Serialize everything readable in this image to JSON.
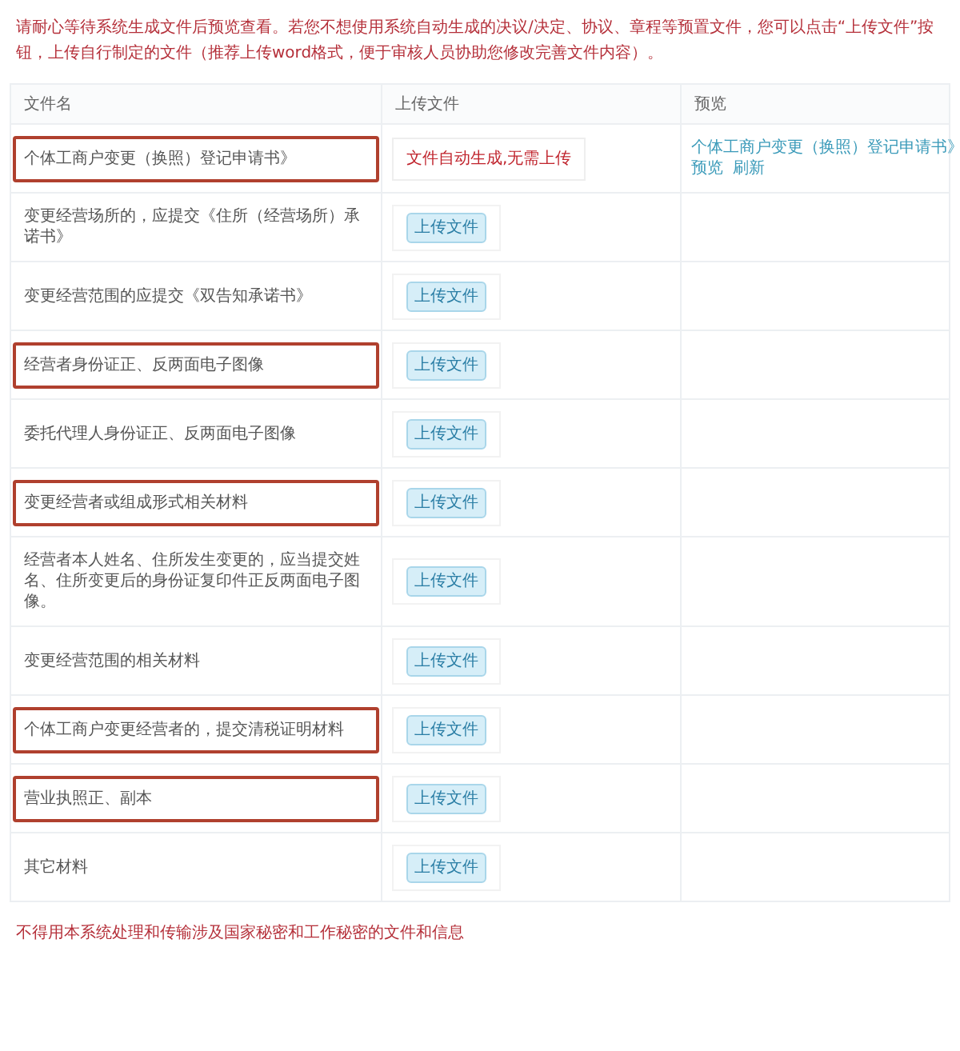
{
  "notice": "请耐心等待系统生成文件后预览查看。若您不想使用系统自动生成的决议/决定、协议、章程等预置文件，您可以点击“上传文件”按钮，上传自行制定的文件（推荐上传word格式，便于审核人员协助您修改完善文件内容）。",
  "table": {
    "columns": [
      "文件名",
      "上传文件",
      "预览"
    ],
    "rows": [
      {
        "name": "个体工商户变更（换照）登记申请书》",
        "highlighted": true,
        "upload": {
          "kind": "auto",
          "label": "文件自动生成,无需上传"
        },
        "preview": {
          "file": "个体工商户变更（换照）登记申请书》",
          "actions": [
            "预览",
            "刷新"
          ]
        }
      },
      {
        "name": "变更经营场所的，应提交《住所（经营场所）承诺书》",
        "highlighted": false,
        "upload": {
          "kind": "button",
          "label": "上传文件"
        }
      },
      {
        "name": "变更经营范围的应提交《双告知承诺书》",
        "highlighted": false,
        "upload": {
          "kind": "button",
          "label": "上传文件"
        }
      },
      {
        "name": "经营者身份证正、反两面电子图像",
        "highlighted": true,
        "upload": {
          "kind": "button",
          "label": "上传文件"
        }
      },
      {
        "name": "委托代理人身份证正、反两面电子图像",
        "highlighted": false,
        "upload": {
          "kind": "button",
          "label": "上传文件"
        }
      },
      {
        "name": "变更经营者或组成形式相关材料",
        "highlighted": true,
        "upload": {
          "kind": "button",
          "label": "上传文件"
        }
      },
      {
        "name": "经营者本人姓名、住所发生变更的，应当提交姓名、住所变更后的身份证复印件正反两面电子图像。",
        "highlighted": false,
        "upload": {
          "kind": "button",
          "label": "上传文件"
        }
      },
      {
        "name": "变更经营范围的相关材料",
        "highlighted": false,
        "upload": {
          "kind": "button",
          "label": "上传文件"
        }
      },
      {
        "name": "个体工商户变更经营者的，提交清税证明材料",
        "highlighted": true,
        "upload": {
          "kind": "button",
          "label": "上传文件"
        }
      },
      {
        "name": "营业执照正、副本",
        "highlighted": true,
        "upload": {
          "kind": "button",
          "label": "上传文件"
        }
      },
      {
        "name": "其它材料",
        "highlighted": false,
        "upload": {
          "kind": "button",
          "label": "上传文件"
        }
      }
    ]
  },
  "footer": "不得用本系统处理和传输涉及国家秘密和工作秘密的文件和信息"
}
